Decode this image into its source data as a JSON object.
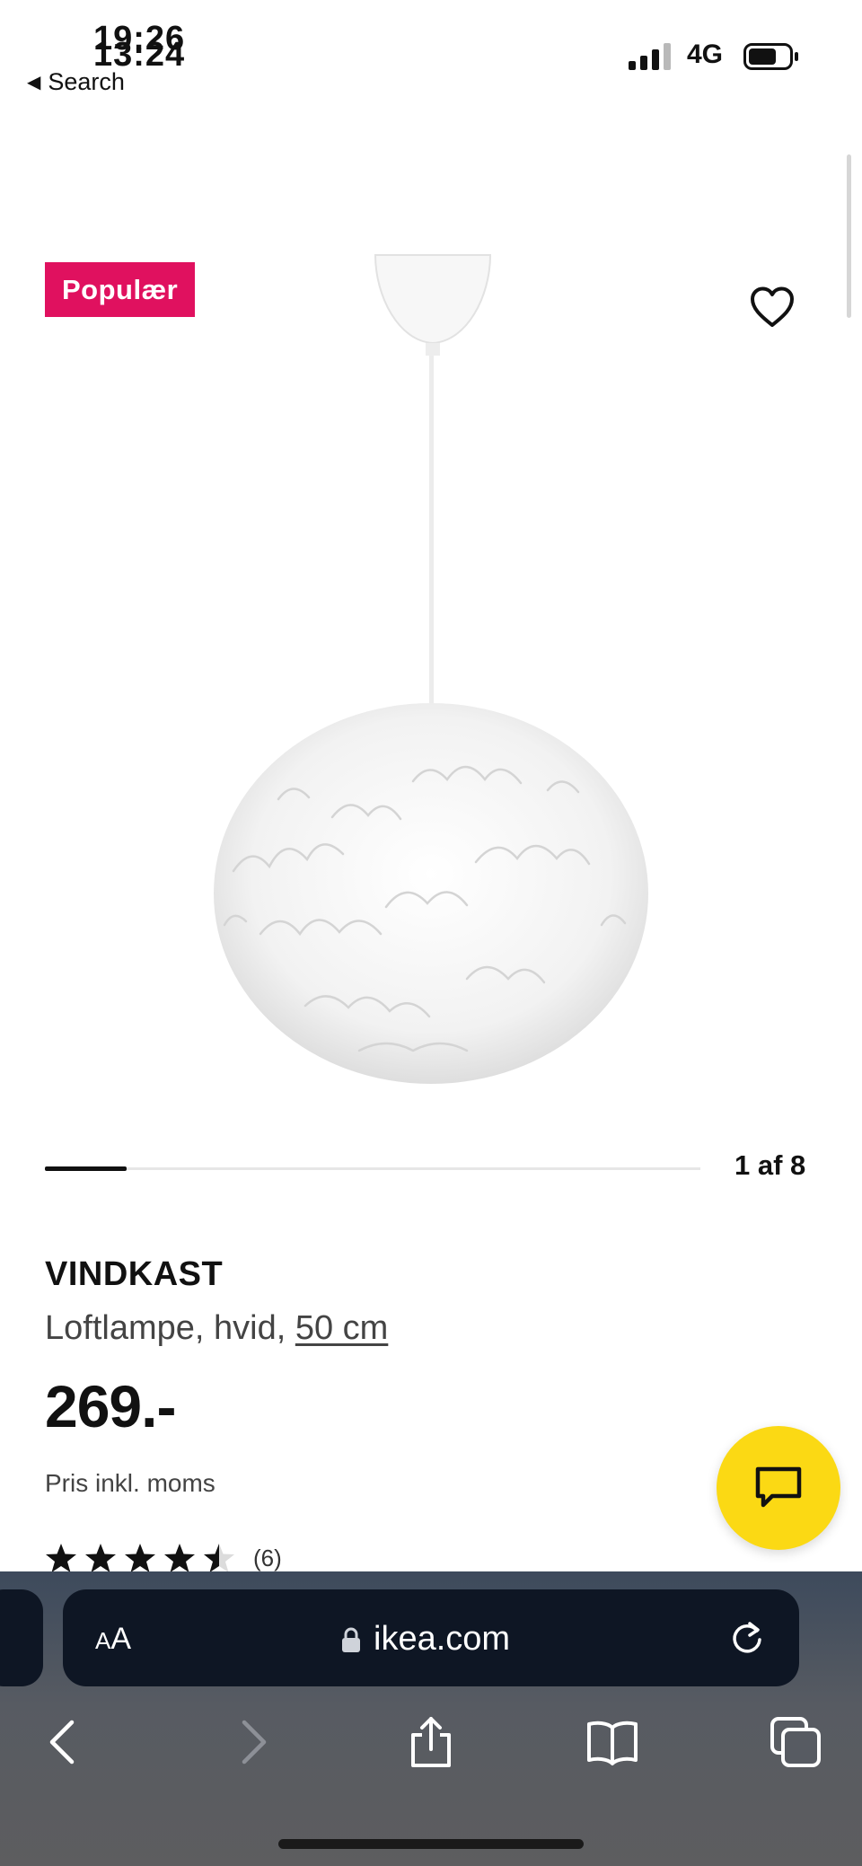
{
  "status_bar": {
    "time_primary": "19:26",
    "time_secondary": "13:24",
    "back_label": "Search",
    "network": "4G"
  },
  "product": {
    "badge": "Populær",
    "gallery_count": "1 af 8",
    "gallery_progress": 0.125,
    "name": "VINDKAST",
    "description": "Loftlampe, hvid,",
    "size_link": "50 cm",
    "price": "269.-",
    "price_note": "Pris inkl. moms",
    "rating_stars": 4.5,
    "rating_count": "(6)"
  },
  "browser": {
    "text_size_label_small": "A",
    "text_size_label_large": "A",
    "url": "ikea.com"
  },
  "icons": {
    "favorite": "heart-icon",
    "chat": "chat-icon",
    "lock": "lock-icon",
    "reload": "reload-icon",
    "back": "chevron-left-icon",
    "forward": "chevron-right-icon",
    "share": "share-icon",
    "bookmarks": "book-icon",
    "tabs": "tabs-icon"
  },
  "colors": {
    "badge": "#e0115f",
    "chat_fab": "#fbd914",
    "url_bar": "#0e1624"
  }
}
